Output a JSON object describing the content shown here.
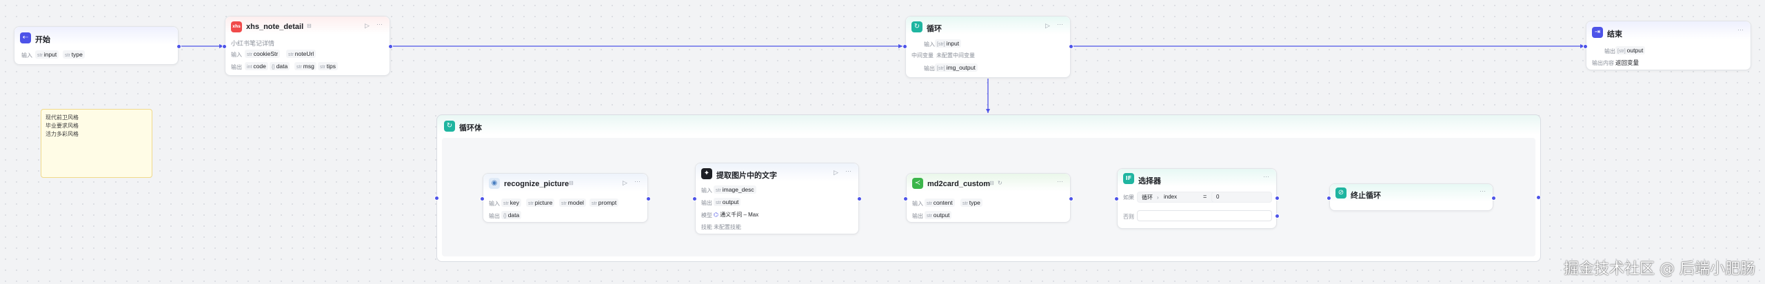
{
  "workflow": {
    "start_node": {
      "title": "开始",
      "input_label": "输入",
      "inputs": [
        {
          "type": "str",
          "name": "input"
        },
        {
          "type": "str",
          "name": "type"
        }
      ]
    },
    "xhs_node": {
      "title": "xhs_note_detail",
      "badge": "xhs",
      "description": "小红书笔记详情",
      "input_label": "输入",
      "inputs": [
        {
          "type": "str",
          "name": "cookieStr"
        },
        {
          "type": "str",
          "name": "noteUrl"
        }
      ],
      "output_label": "输出",
      "outputs": [
        {
          "type": "int",
          "name": "code"
        },
        {
          "type": "{}",
          "name": "data"
        },
        {
          "type": "str",
          "name": "msg"
        },
        {
          "type": "str",
          "name": "tips"
        }
      ]
    },
    "loop_node": {
      "title": "循环",
      "input_label": "输入",
      "inputs": [
        {
          "type": "[str]",
          "name": "input"
        }
      ],
      "vars_label": "中间变量",
      "vars_value": "未配置中间变量",
      "output_label": "输出",
      "outputs": [
        {
          "type": "[str]",
          "name": "img_output"
        }
      ]
    },
    "end_node": {
      "title": "结束",
      "output_label": "输出",
      "outputs": [
        {
          "type": "[str]",
          "name": "output"
        }
      ],
      "content_label": "输出内容",
      "content_value": "返回变量"
    },
    "note": {
      "lines": [
        "现代前卫风格",
        "毕业要求风格",
        "活力多彩风格"
      ]
    },
    "loop_body": {
      "title": "循环体"
    },
    "recognize_node": {
      "title": "recognize_picture",
      "input_label": "输入",
      "inputs": [
        {
          "type": "str",
          "name": "key"
        },
        {
          "type": "str",
          "name": "picture"
        },
        {
          "type": "str",
          "name": "model"
        },
        {
          "type": "str",
          "name": "prompt"
        }
      ],
      "output_label": "输出",
      "outputs": [
        {
          "type": "{}",
          "name": "data"
        }
      ]
    },
    "extract_node": {
      "title": "提取图片中的文字",
      "input_label": "输入",
      "inputs": [
        {
          "type": "str",
          "name": "image_desc"
        }
      ],
      "output_label": "输出",
      "outputs": [
        {
          "type": "str",
          "name": "output"
        }
      ],
      "model_label": "模型",
      "model_value": "通义千问 – Max",
      "skills_label": "技能",
      "skills_value": "未配置技能"
    },
    "md2card_node": {
      "title": "md2card_custom",
      "input_label": "输入",
      "inputs": [
        {
          "type": "str",
          "name": "content"
        },
        {
          "type": "str",
          "name": "type"
        }
      ],
      "output_label": "输出",
      "outputs": [
        {
          "type": "str",
          "name": "output"
        }
      ]
    },
    "selector_node": {
      "title": "选择器",
      "if_label": "如果",
      "var_prefix": "循环",
      "var_name": "index",
      "operator": "=",
      "compare_value": "0",
      "else_label": "否则"
    },
    "break_node": {
      "title": "终止循环"
    },
    "actions": {
      "run": "▷",
      "more": "···"
    },
    "watermark": "掘金技术社区 @ 后端小肥肠"
  }
}
